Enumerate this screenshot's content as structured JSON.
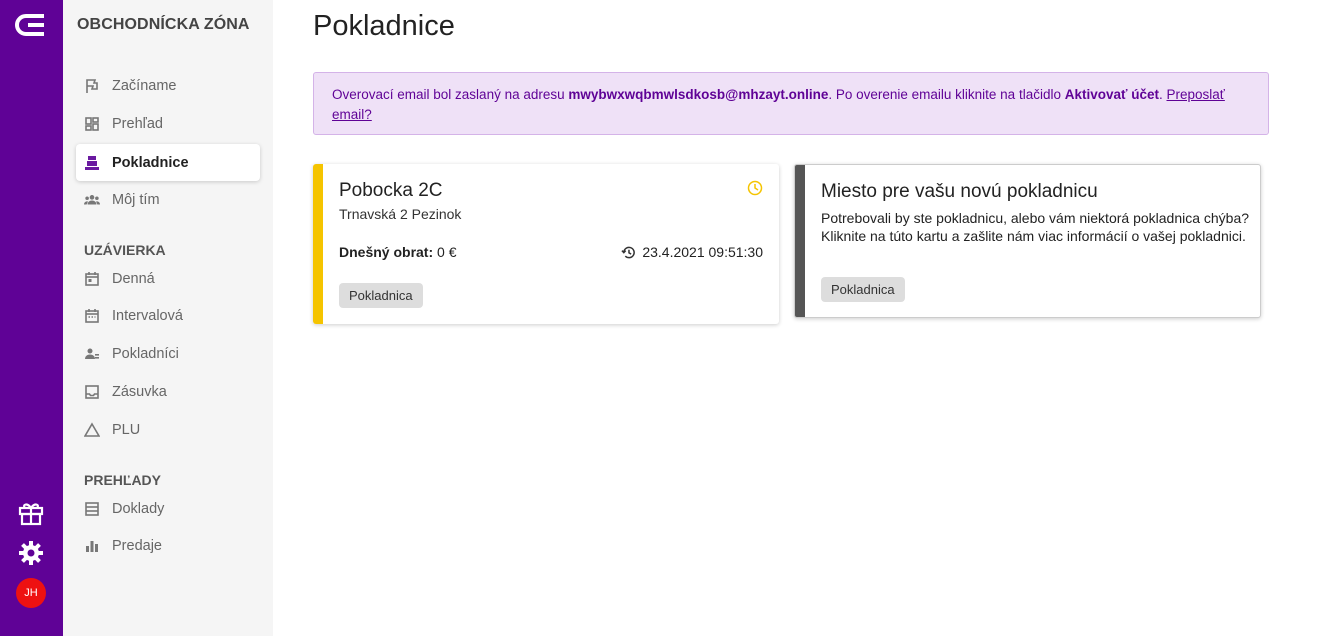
{
  "rail": {
    "avatar_initials": "JH",
    "brand_color": "#5f0296",
    "avatar_color": "#ee1111"
  },
  "sidebar": {
    "zone_title": "OBCHODNÍCKA ZÓNA",
    "items": [
      {
        "label": "Začíname",
        "icon": "flag-icon"
      },
      {
        "label": "Prehľad",
        "icon": "dashboard-icon"
      },
      {
        "label": "Pokladnice",
        "icon": "cash-register-icon",
        "active": true
      },
      {
        "label": "Môj tím",
        "icon": "team-icon"
      }
    ],
    "sections": [
      {
        "title": "UZÁVIERKA",
        "items": [
          {
            "label": "Denná",
            "icon": "calendar-day-icon"
          },
          {
            "label": "Intervalová",
            "icon": "calendar-range-icon"
          },
          {
            "label": "Pokladníci",
            "icon": "cashiers-icon"
          },
          {
            "label": "Zásuvka",
            "icon": "drawer-icon"
          },
          {
            "label": "PLU",
            "icon": "triangle-icon"
          }
        ]
      },
      {
        "title": "PREHĽADY",
        "items": [
          {
            "label": "Doklady",
            "icon": "receipts-icon"
          },
          {
            "label": "Predaje",
            "icon": "bar-chart-icon"
          }
        ]
      }
    ]
  },
  "main": {
    "title": "Pokladnice",
    "alert": {
      "prefix": "Overovací email bol zaslaný na adresu ",
      "email": "mwybwxwqbmwlsdkosb@mhzayt.online",
      "middle": ". Po overenie emailu kliknite na tlačidlo ",
      "action": "Aktivovať účet",
      "suffix": ". ",
      "resend_link": "Preposlať email?"
    },
    "cards": [
      {
        "title": "Pobocka 2C",
        "address": "Trnavská 2 Pezinok",
        "turnover_label": "Dnešný obrat:",
        "turnover_value": " 0 €",
        "last_sync": "23.4.2021 09:51:30",
        "chip": "Pokladnica",
        "accent": "#f5c400"
      },
      {
        "title": "Miesto pre vašu novú pokladnicu",
        "text": "Potrebovali by ste pokladnicu, alebo vám niektorá pokladnica chýba? Kliknite na túto kartu a zašlite nám viac informácií o vašej pokladnici.",
        "chip": "Pokladnica",
        "accent": "#555555"
      }
    ]
  }
}
